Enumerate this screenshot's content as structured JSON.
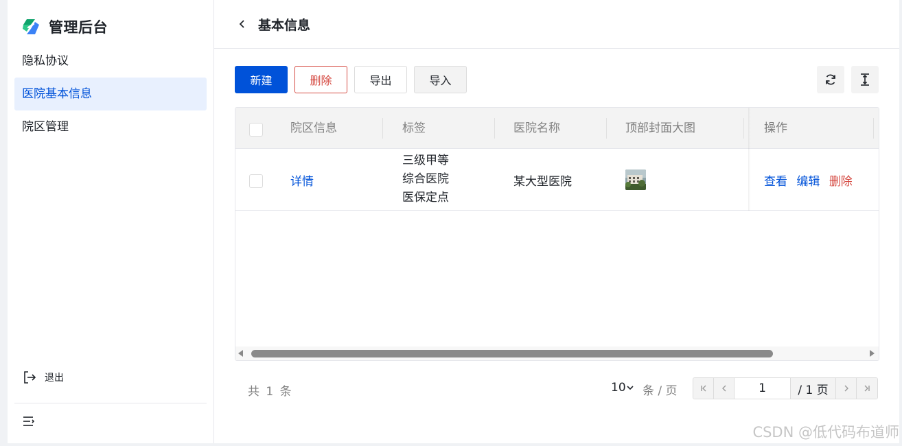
{
  "app": {
    "title": "管理后台"
  },
  "sidebar": {
    "items": [
      {
        "label": "隐私协议"
      },
      {
        "label": "医院基本信息",
        "active": true
      },
      {
        "label": "院区管理"
      }
    ],
    "logout_label": "退出"
  },
  "header": {
    "title": "基本信息"
  },
  "toolbar": {
    "new_label": "新建",
    "delete_label": "删除",
    "export_label": "导出",
    "import_label": "导入"
  },
  "table": {
    "columns": [
      "院区信息",
      "标签",
      "医院名称",
      "顶部封面大图",
      "操作"
    ],
    "rows": [
      {
        "campus_info": "详情",
        "tags": [
          "三级甲等",
          "综合医院",
          "医保定点"
        ],
        "hospital_name": "某大型医院",
        "actions": {
          "view": "查看",
          "edit": "编辑",
          "delete": "删除"
        }
      }
    ]
  },
  "pagination": {
    "total_text": "共 1 条",
    "page_size": "10",
    "page_size_unit": "条 / 页",
    "current_page": "1",
    "total_pages_text": "/ 1 页"
  },
  "watermark": "CSDN @低代码布道师",
  "colors": {
    "primary": "#0052d9",
    "danger": "#d54941",
    "active_bg": "#e8f0fe"
  }
}
